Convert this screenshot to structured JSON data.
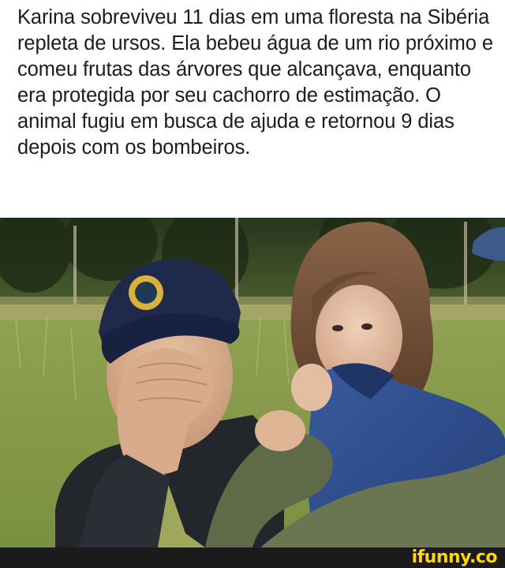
{
  "caption": {
    "text": "Karina sobreviveu 11 dias em uma floresta na Sibéria repleta de ursos. Ela bebeu água de um rio próximo e comeu frutas das árvores que alcançava, enquanto era protegida por seu cachorro de estimação. O animal fugiu em busca de ajuda e retornou 9 dias depois com os bombeiros."
  },
  "footer": {
    "watermark": "ifunny.co"
  },
  "colors": {
    "footer_bg": "#1b1b1b",
    "watermark": "#ffd60a",
    "caption_text": "#1c1c1c"
  }
}
